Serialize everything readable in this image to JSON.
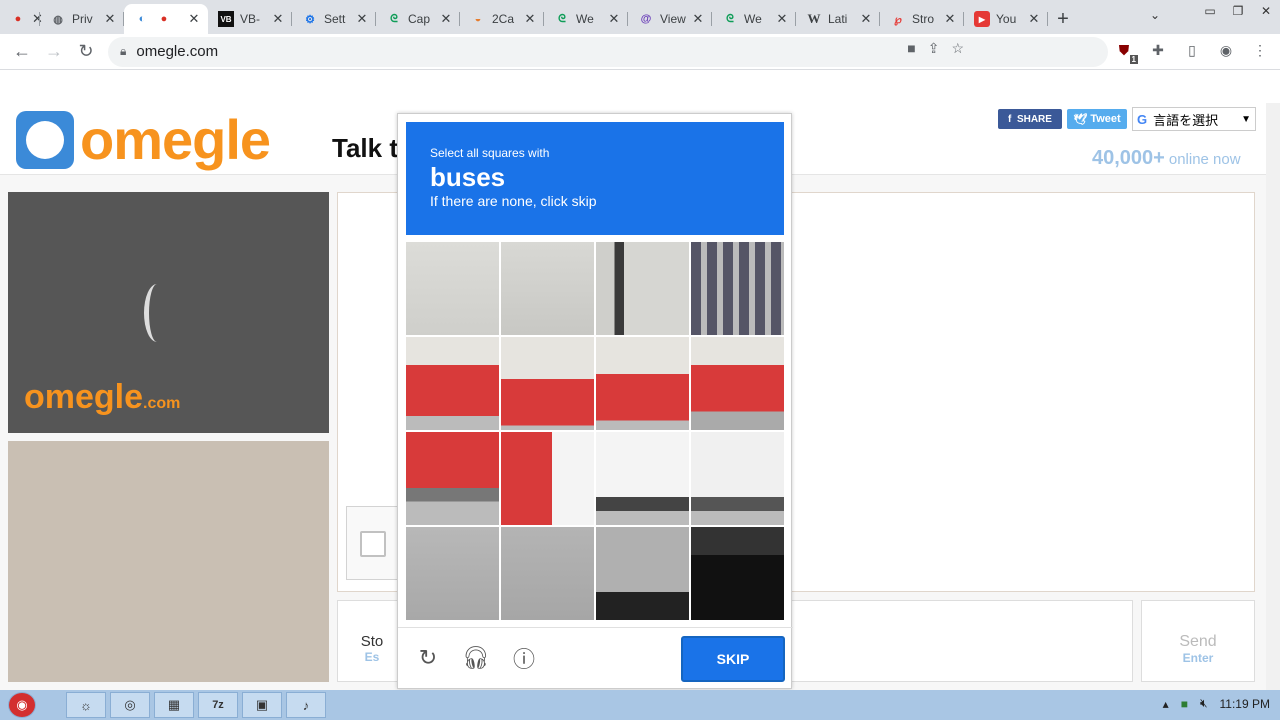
{
  "browser": {
    "tabs": [
      {
        "label": "",
        "icon": "record-icon"
      },
      {
        "label": "Priv",
        "icon": "globe-icon"
      },
      {
        "label": "",
        "icon": "omegle-icon",
        "active": true
      },
      {
        "label": "VB-",
        "icon": "vb-icon"
      },
      {
        "label": "Sett",
        "icon": "gear-icon"
      },
      {
        "label": "Cap",
        "icon": "spiral-icon"
      },
      {
        "label": "2Ca",
        "icon": "captcha-icon"
      },
      {
        "label": "We",
        "icon": "spiral-icon"
      },
      {
        "label": "View",
        "icon": "at-icon"
      },
      {
        "label": "We",
        "icon": "spiral-icon"
      },
      {
        "label": "Lati",
        "icon": "wikipedia-icon"
      },
      {
        "label": "Stro",
        "icon": "p-icon"
      },
      {
        "label": "You",
        "icon": "youtube-icon"
      }
    ],
    "url": "omegle.com",
    "extension_badge": "1"
  },
  "omegle": {
    "logo_text": "omegle",
    "tagline": "Talk t",
    "share_label": "SHARE",
    "tweet_label": "Tweet",
    "translate_label": "言語を選択",
    "online_count": "40,000+",
    "online_label": "online now",
    "watermark": "omegle",
    "watermark_suffix": ".com",
    "stop_label": "Sto",
    "stop_hint": "Es",
    "send_label": "Send",
    "send_hint": "Enter"
  },
  "captcha": {
    "instruction": "Select all squares with",
    "target": "buses",
    "subtext": "If there are none, click skip",
    "skip_label": "SKIP",
    "grid_size": 4
  },
  "taskbar": {
    "time": "11:19 PM"
  }
}
